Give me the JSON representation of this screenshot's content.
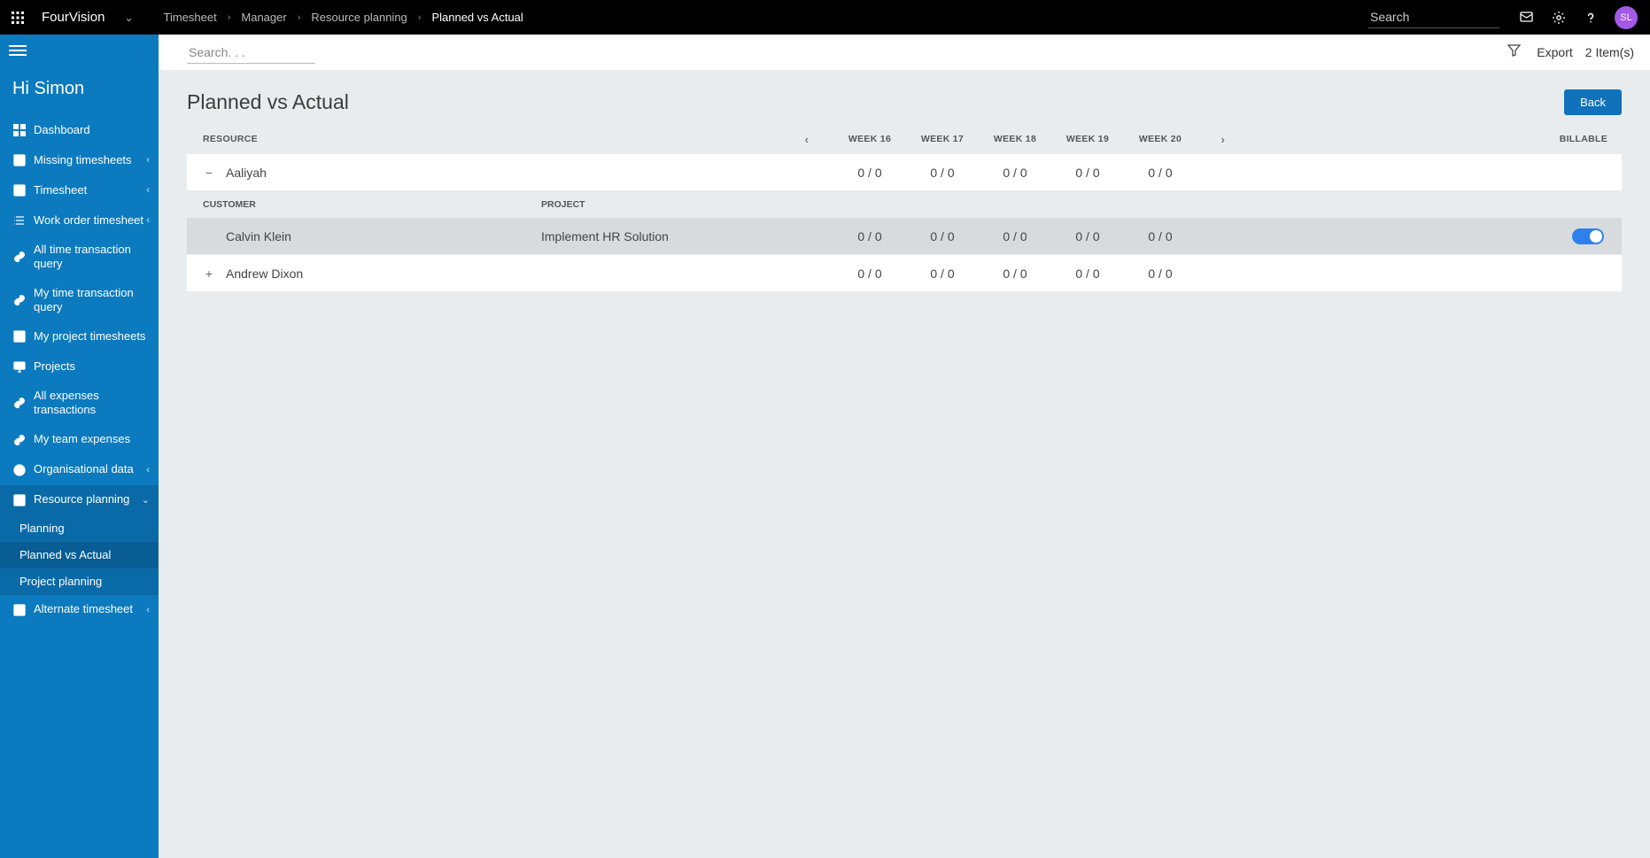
{
  "topbar": {
    "brand": "FourVision",
    "breadcrumbs": [
      "Timesheet",
      "Manager",
      "Resource planning",
      "Planned vs Actual"
    ],
    "search_placeholder": "Search",
    "avatar_initials": "SL"
  },
  "sidebar": {
    "greeting": "Hi Simon",
    "items": [
      {
        "label": "Dashboard",
        "icon": "dashboard-icon",
        "chevron": false
      },
      {
        "label": "Missing timesheets",
        "icon": "sheet-icon",
        "chevron": true
      },
      {
        "label": "Timesheet",
        "icon": "sheet-icon",
        "chevron": true
      },
      {
        "label": "Work order timesheet",
        "icon": "list-icon",
        "chevron": true
      },
      {
        "label": "All time transaction query",
        "icon": "link-icon",
        "chevron": false
      },
      {
        "label": "My time transaction query",
        "icon": "link-icon",
        "chevron": false
      },
      {
        "label": "My project timesheets",
        "icon": "sheet-icon",
        "chevron": false
      },
      {
        "label": "Projects",
        "icon": "monitor-icon",
        "chevron": false
      },
      {
        "label": "All expenses transactions",
        "icon": "link-icon",
        "chevron": false
      },
      {
        "label": "My team expenses",
        "icon": "link-icon",
        "chevron": false
      },
      {
        "label": "Organisational data",
        "icon": "globe-icon",
        "chevron": true
      },
      {
        "label": "Resource planning",
        "icon": "sheet-icon",
        "chevron": true,
        "expanded": true,
        "children": [
          {
            "label": "Planning",
            "active": false
          },
          {
            "label": "Planned vs Actual",
            "active": true
          },
          {
            "label": "Project planning",
            "active": false
          }
        ]
      },
      {
        "label": "Alternate timesheet",
        "icon": "sheet-icon",
        "chevron": true
      }
    ]
  },
  "toolbar": {
    "search_placeholder": "Search. . .",
    "export_label": "Export",
    "item_count": "2 Item(s)"
  },
  "page": {
    "title": "Planned vs Actual",
    "back_label": "Back"
  },
  "table": {
    "headers": {
      "resource": "RESOURCE",
      "customer": "CUSTOMER",
      "project": "PROJECT",
      "weeks": [
        "WEEK 16",
        "WEEK 17",
        "WEEK 18",
        "WEEK 19",
        "WEEK 20"
      ],
      "billable": "BILLABLE"
    },
    "rows": [
      {
        "type": "resource",
        "expanded": true,
        "name": "Aaliyah",
        "weeks": [
          "0 / 0",
          "0 / 0",
          "0 / 0",
          "0 / 0",
          "0 / 0"
        ],
        "details": [
          {
            "customer": "Calvin Klein",
            "project": "Implement HR Solution",
            "weeks": [
              "0 / 0",
              "0 / 0",
              "0 / 0",
              "0 / 0",
              "0 / 0"
            ],
            "billable": true
          }
        ]
      },
      {
        "type": "resource",
        "expanded": false,
        "name": "Andrew Dixon",
        "weeks": [
          "0 / 0",
          "0 / 0",
          "0 / 0",
          "0 / 0",
          "0 / 0"
        ]
      }
    ]
  }
}
